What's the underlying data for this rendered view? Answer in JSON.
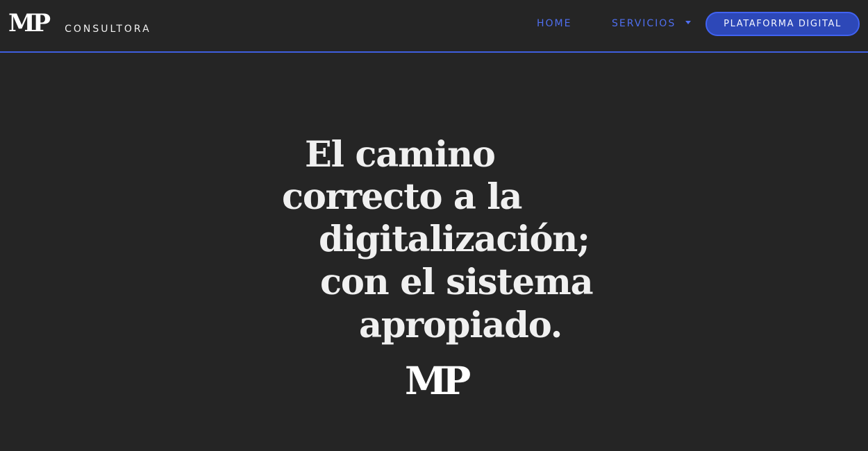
{
  "navbar": {
    "brand_logo": "MP",
    "brand_text": "CONSULTORA",
    "links": [
      {
        "label": "HOME"
      },
      {
        "label": "SERVICIOS"
      }
    ],
    "platform_button": "PLATAFORMA DIGITAL"
  },
  "hero": {
    "lines": [
      "El camino",
      "correcto a la",
      "digitalización;",
      "con el sistema",
      "apropiado."
    ],
    "logo": "MP"
  },
  "colors": {
    "background": "#252525",
    "accent": "#3f5fe0",
    "nav_link": "#4f6ff0",
    "button": "#2d48b8",
    "text": "#f0f0f0"
  },
  "icons": {
    "dropdown": "chevron-down-icon"
  }
}
